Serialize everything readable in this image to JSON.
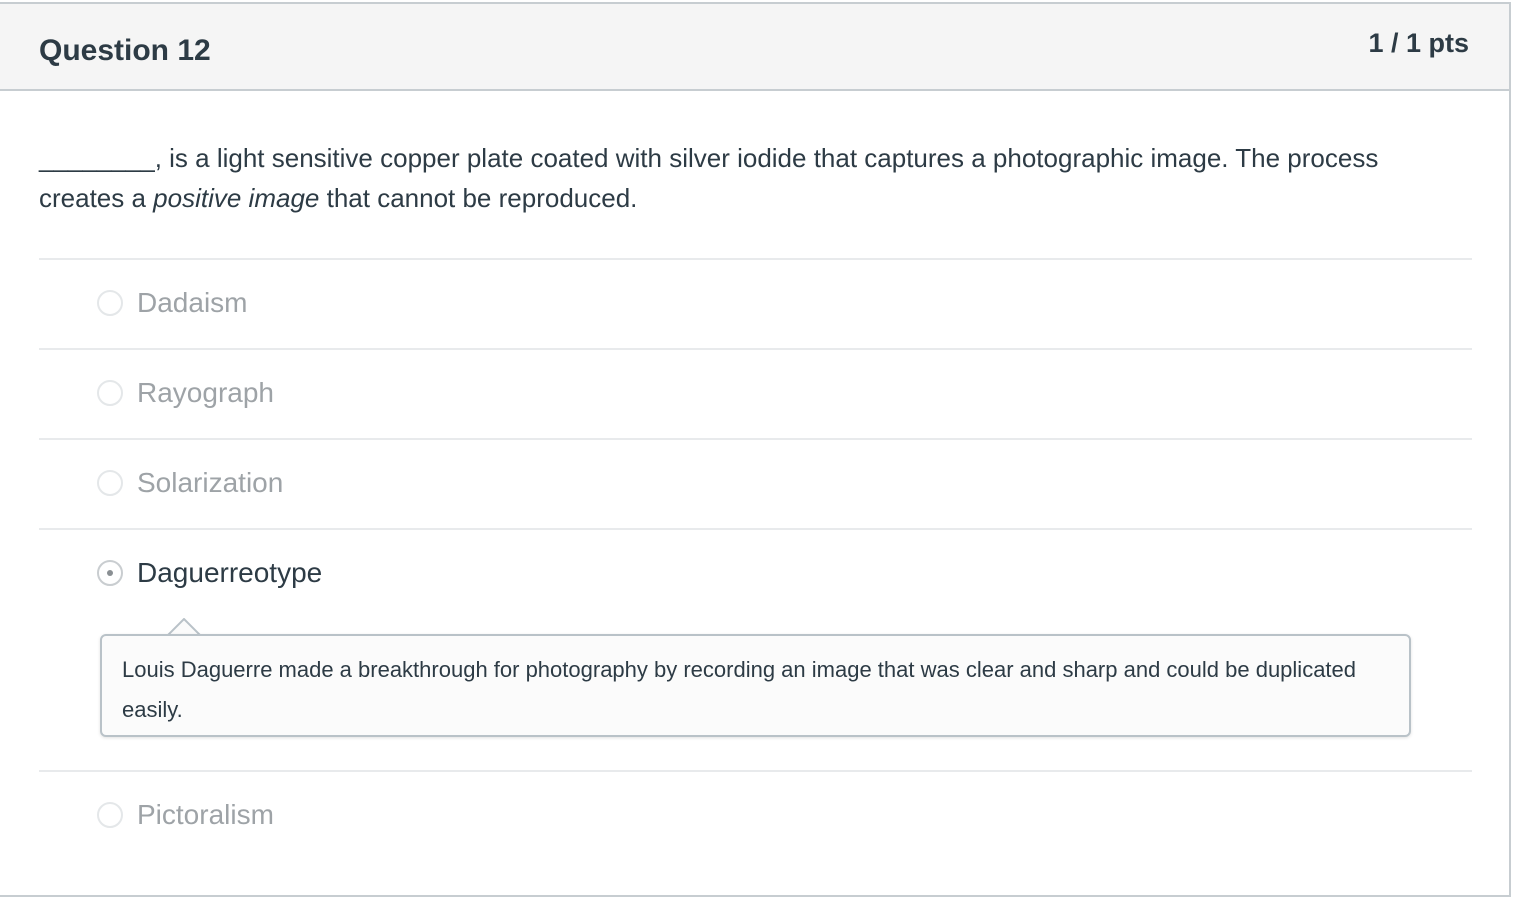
{
  "question": {
    "title": "Question 12",
    "points": "1 / 1 pts",
    "text_blank": "________",
    "text_part1": ", is a light sensitive copper plate coated with silver iodide that captures a photographic image.  The process creates a ",
    "text_emphasis": "positive image",
    "text_part2": " that cannot be reproduced."
  },
  "answers": [
    {
      "label": "Dadaism",
      "selected": false
    },
    {
      "label": "Rayograph",
      "selected": false
    },
    {
      "label": "Solarization",
      "selected": false
    },
    {
      "label": "Daguerreotype",
      "selected": true,
      "correct": true
    },
    {
      "label": "Pictoralism",
      "selected": false
    }
  ],
  "comment": {
    "text": "Louis Daguerre made a breakthrough for photography by recording an image that was clear and sharp and could be duplicated easily."
  },
  "colors": {
    "correct_marker": "#2ba33f",
    "header_bg": "#f5f5f5",
    "border": "#c7cdd1"
  },
  "icons": {
    "correct_marker": "correct-answer-arrow-icon"
  }
}
